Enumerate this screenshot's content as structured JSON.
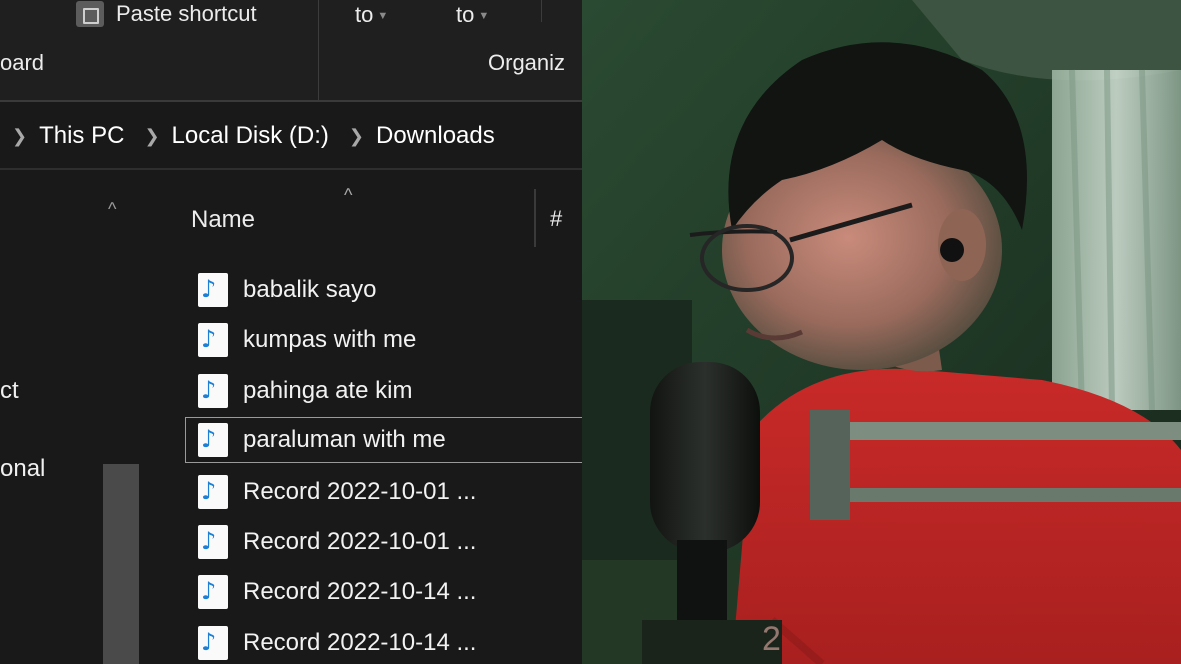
{
  "ribbon": {
    "paste_shortcut": "Paste shortcut",
    "move_to": "to",
    "copy_to": "to",
    "clipboard_label": "oard",
    "organize_label": "Organiz"
  },
  "breadcrumb": {
    "items": [
      "This PC",
      "Local Disk (D:)",
      "Downloads"
    ]
  },
  "nav": {
    "items": [
      "ct",
      "onal"
    ]
  },
  "files": {
    "columns": {
      "name": "Name",
      "number": "#"
    },
    "items": [
      "babalik sayo",
      "kumpas with me",
      "pahinga ate kim",
      "paraluman with me",
      "Record 2022-10-01 ...",
      "Record 2022-10-01 ...",
      "Record 2022-10-14 ...",
      "Record 2022-10-14 ..."
    ],
    "selected_index": 3
  },
  "webcam": {
    "shirt_text": "2"
  },
  "colors": {
    "background": "#191919",
    "ribbon": "#1f1f1f",
    "audio_icon": "#1d7fd4",
    "shirt": "#d02828"
  }
}
